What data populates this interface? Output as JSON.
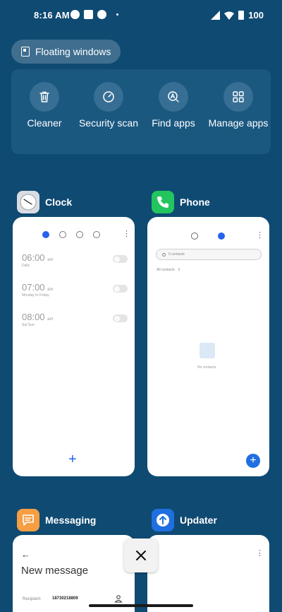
{
  "status_bar": {
    "time": "8:16 AM",
    "battery": "100"
  },
  "floating": {
    "label": "Floating windows"
  },
  "actions": [
    {
      "label": "Cleaner",
      "icon": "trash-icon"
    },
    {
      "label": "Security scan",
      "icon": "shield-gauge-icon"
    },
    {
      "label": "Find apps",
      "icon": "find-app-icon"
    },
    {
      "label": "Manage apps",
      "icon": "grid-icon"
    }
  ],
  "apps": {
    "clock": {
      "title": "Clock",
      "alarms": [
        {
          "time": "06:00",
          "ampm": "am",
          "sub": "Daily"
        },
        {
          "time": "07:00",
          "ampm": "am",
          "sub": "Monday to Friday"
        },
        {
          "time": "08:00",
          "ampm": "am",
          "sub": "Sat Sun"
        }
      ]
    },
    "phone": {
      "title": "Phone",
      "search_placeholder": "0 contacts",
      "filter": "All contacts",
      "empty_text": "No contacts"
    },
    "messaging": {
      "title": "Messaging",
      "heading": "New message",
      "recipient_label": "Recipient:",
      "recipient_value": "18730218809"
    },
    "updater": {
      "title": "Updater"
    }
  },
  "colors": {
    "background": "#0f4a72",
    "accent": "#2563eb",
    "clock_icon": "#d9dde2",
    "phone_icon": "#22c55e",
    "messaging_icon": "#f59e42",
    "updater_icon": "#1f6fe0"
  }
}
